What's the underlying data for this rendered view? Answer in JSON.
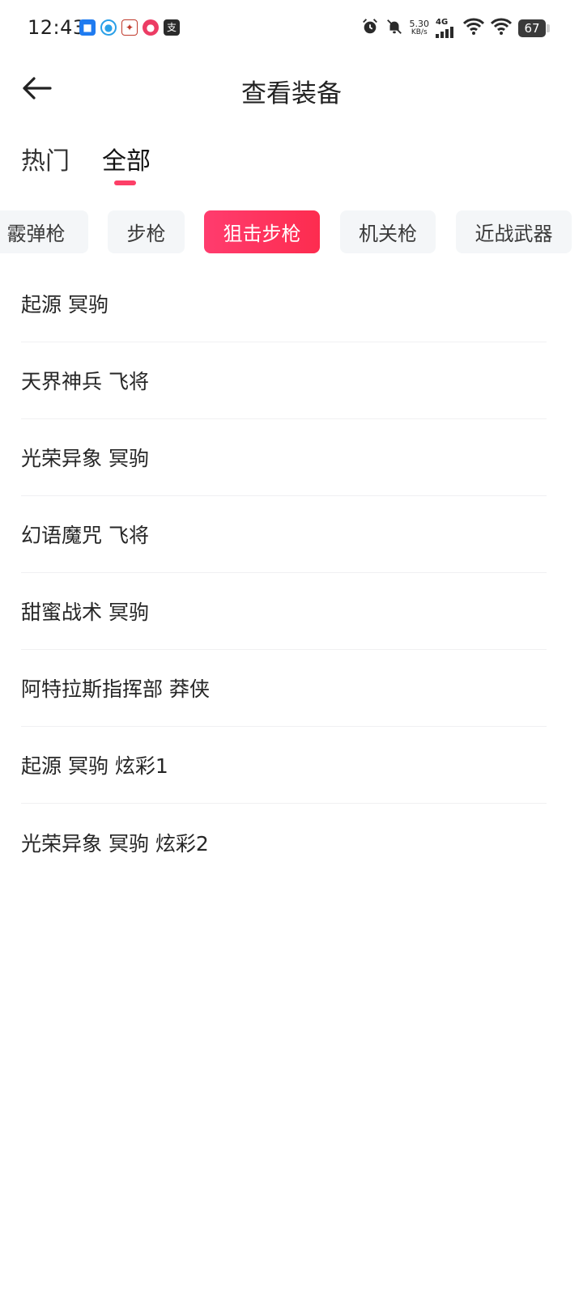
{
  "status_bar": {
    "time": "12:43",
    "net_speed_value": "5.30",
    "net_speed_unit": "KB/s",
    "signal_type": "4G",
    "battery": "67",
    "apps": [
      "app-icon-1",
      "app-icon-2",
      "app-icon-3",
      "app-icon-4",
      "alipay-icon"
    ]
  },
  "header": {
    "title": "查看装备"
  },
  "tabs": [
    {
      "label": "热门",
      "active": false
    },
    {
      "label": "全部",
      "active": true
    }
  ],
  "categories": [
    {
      "label": "霰弹枪",
      "active": false
    },
    {
      "label": "步枪",
      "active": false
    },
    {
      "label": "狙击步枪",
      "active": true
    },
    {
      "label": "机关枪",
      "active": false
    },
    {
      "label": "近战武器",
      "active": false
    }
  ],
  "items": [
    "起源 冥驹",
    "天界神兵 飞将",
    "光荣异象 冥驹",
    "幻语魔咒 飞将",
    "甜蜜战术 冥驹",
    "阿特拉斯指挥部 莽侠",
    "起源 冥驹 炫彩1",
    "光荣异象 冥驹 炫彩2"
  ],
  "colors": {
    "accent": "#fd3f67",
    "chip_bg": "#f4f6f8",
    "divider": "#f0f0f2"
  }
}
